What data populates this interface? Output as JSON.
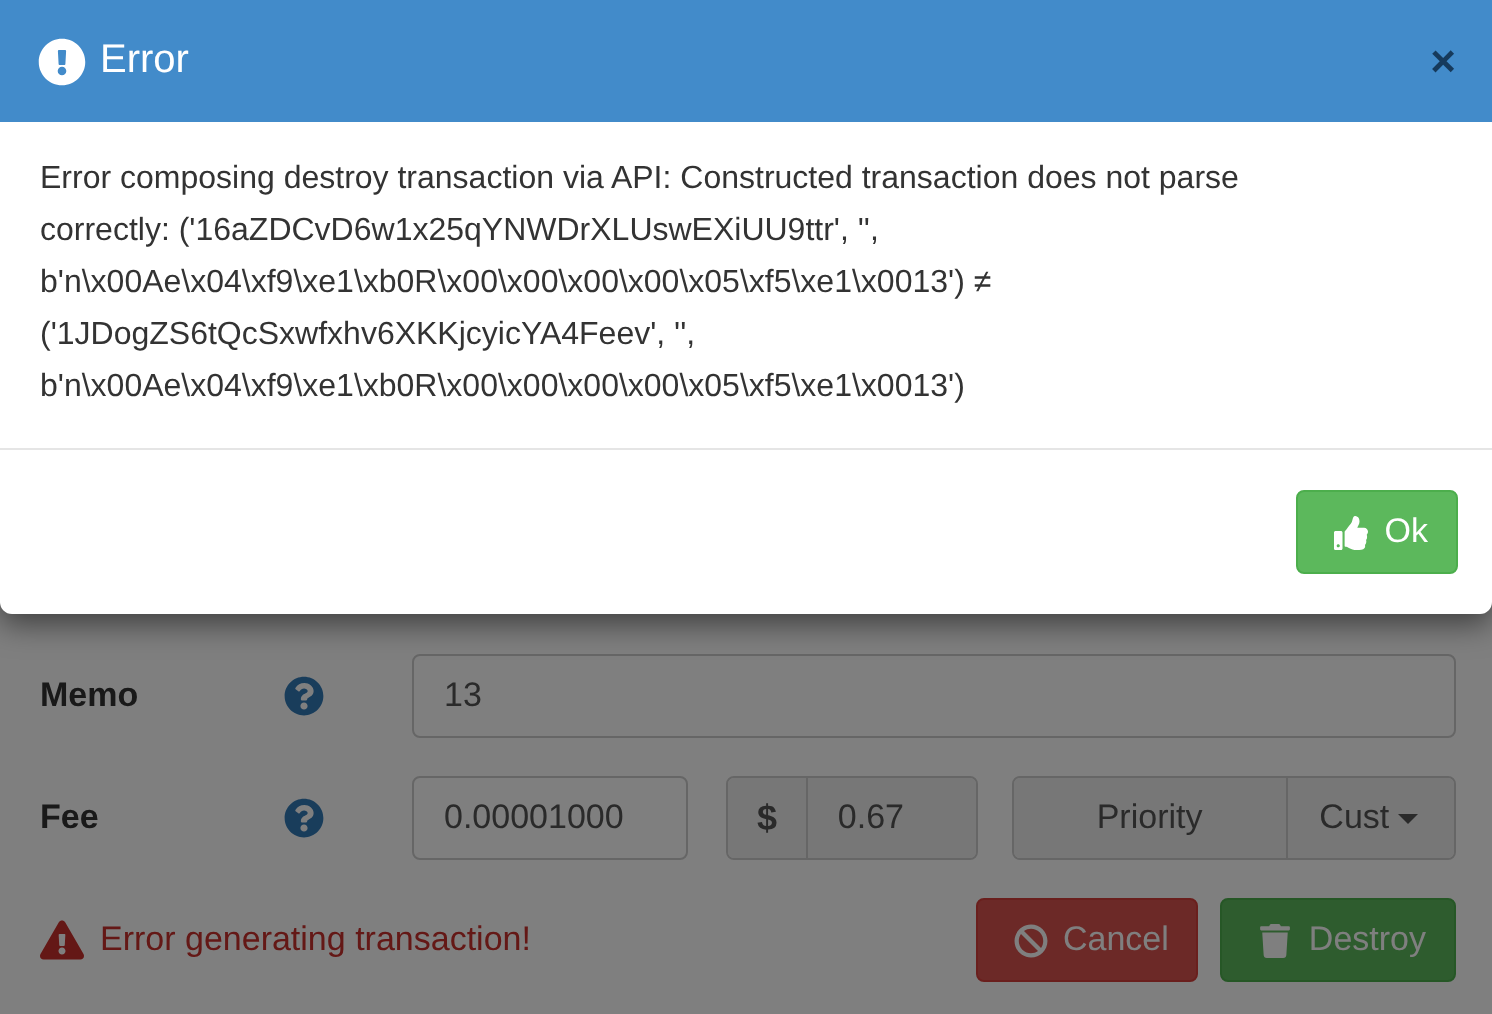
{
  "modal": {
    "title": "Error",
    "close": "×",
    "message": "Error composing destroy transaction via API: Constructed transaction does not parse correctly: ('16aZDCvD6w1x25qYNWDrXLUswEXiUU9ttr', '', b'n\\x00Ae\\x04\\xf9\\xe1\\xb0R\\x00\\x00\\x00\\x00\\x05\\xf5\\xe1\\x0013') ≠ ('1JDogZS6tQcSxwfxhv6XKKjcyicYA4Feev', '', b'n\\x00Ae\\x04\\xf9\\xe1\\xb0R\\x00\\x00\\x00\\x00\\x05\\xf5\\xe1\\x0013')",
    "ok": "Ok"
  },
  "form": {
    "memo": {
      "label": "Memo",
      "value": "13"
    },
    "fee": {
      "label": "Fee",
      "value": "0.00001000",
      "currency": "$",
      "usd": "0.67",
      "priority": "Priority",
      "mode": "Cust"
    },
    "error": "Error generating transaction!",
    "cancel": "Cancel",
    "destroy": "Destroy"
  }
}
